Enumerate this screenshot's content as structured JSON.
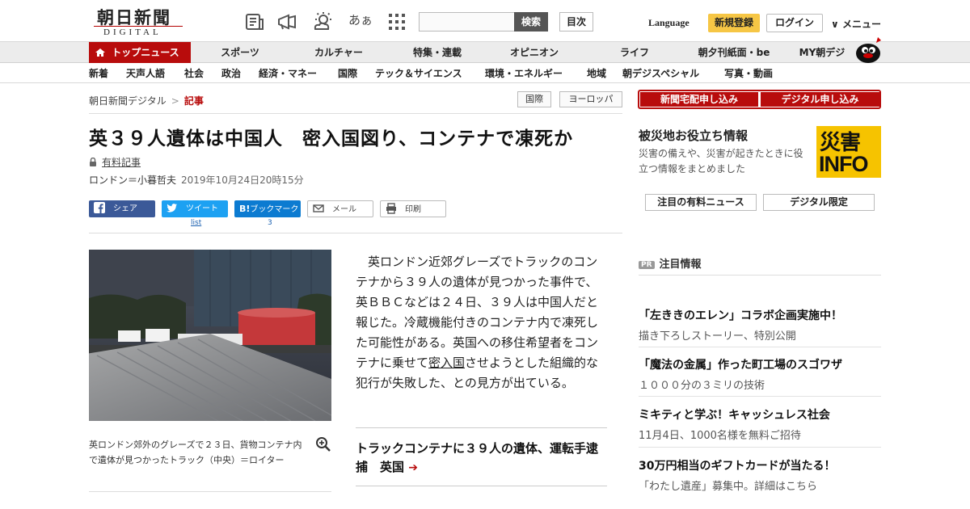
{
  "header": {
    "logo_kanji": "朝日新聞",
    "logo_latin": "DIGITAL",
    "font_size_icon_label": "あぁ",
    "search": {
      "placeholder": "",
      "button": "検索"
    },
    "toc_button": "目次",
    "language": "Language",
    "signup": "新規登録",
    "login": "ログイン",
    "menu": "メニュー"
  },
  "primary_nav": [
    "トップニュース",
    "スポーツ",
    "カルチャー",
    "特集・連載",
    "オピニオン",
    "ライフ",
    "朝夕刊紙面・be",
    "MY朝デジ"
  ],
  "sub_nav": [
    "新着",
    "天声人語",
    "社会",
    "政治",
    "経済・マネー",
    "国際",
    "テック＆サイエンス",
    "環境・エネルギー",
    "地域",
    "朝デジスペシャル",
    "写真・動画"
  ],
  "breadcrumb": {
    "home": "朝日新聞デジタル",
    "sep": ">",
    "current": "記事"
  },
  "tags": [
    "国際",
    "ヨーロッパ"
  ],
  "article": {
    "title": "英３９人遺体は中国人　密入国図り、コンテナで凍死か",
    "paid_label": "有料記事",
    "author": "ロンドン＝小暮哲夫",
    "timestamp": "2019年10月24日20時15分",
    "body_1": "英ロンドン近郊グレーズでトラックのコンテナから３９人の遺体が見つかった事件で、英ＢＢＣなどは２４日、３９人は中国人だと報じた。冷蔵機能付きのコンテナ内で凍死した可能性がある。英国への移住希望者をコンテナに乗せて",
    "body_keyword": "密入国",
    "body_2": "させようとした組織的な犯行が失敗した、との見方が出ている。",
    "photo_caption": "英ロンドン郊外のグレーズで２３日、貨物コンテナ内で遺体が見つかったトラック（中央）＝ロイター",
    "related_link": "トラックコンテナに３９人の遺体、運転手逮捕　英国"
  },
  "share": {
    "facebook": "シェア",
    "twitter": "ツイート",
    "twitter_count": "list",
    "hatena": "ブックマーク",
    "hatena_count": "3",
    "mail": "メール",
    "print": "印刷"
  },
  "sidebar": {
    "subscribe_paper": "新聞宅配申し込み",
    "subscribe_digital": "デジタル申し込み",
    "disaster_title": "被災地お役立ち情報",
    "disaster_desc": "災害の備えや、災害が起きたときに役立つ情報をまとめました",
    "disaster_logo_kanji": "災害",
    "disaster_logo_latin": "INFO",
    "tab_paid_news": "注目の有料ニュース",
    "tab_digital_limited": "デジタル限定",
    "pr_badge": "PR",
    "pr_header": "注目情報",
    "pr_items": [
      {
        "title": "「左ききのエレン」コラボ企画実施中！",
        "desc": "描き下ろしストーリー、特別公開"
      },
      {
        "title": "「魔法の金属」作った町工場のスゴワザ",
        "desc": "１０００分の３ミリの技術"
      },
      {
        "title": "ミキティと学ぶ！キャッシュレス社会",
        "desc": "11月4日、1000名様を無料ご招待"
      },
      {
        "title": "30万円相当のギフトカードが当たる！",
        "desc": "「わたし遺産」募集中。詳細はこちら"
      }
    ]
  },
  "colors": {
    "brand_red": "#b80c0c",
    "signup_yellow": "#f6c645",
    "disaster_yellow": "#f6c300"
  }
}
